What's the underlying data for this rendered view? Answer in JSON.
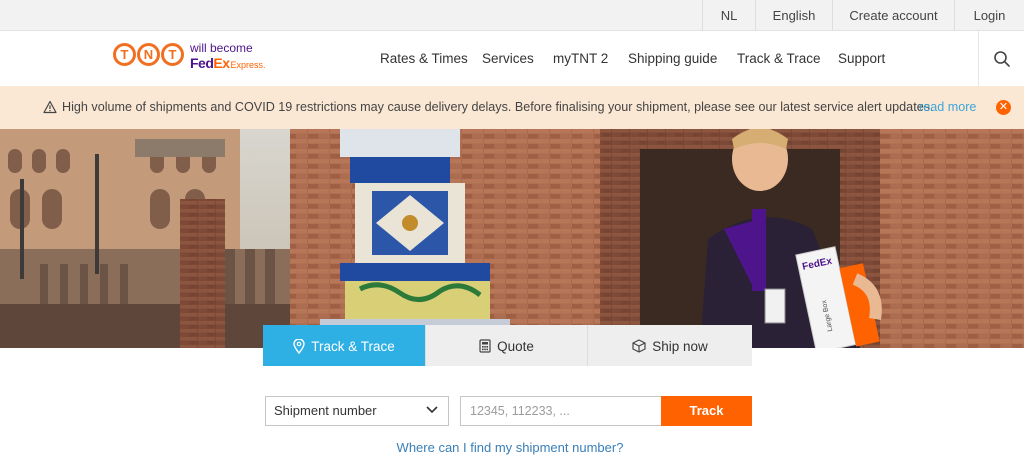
{
  "topbar": {
    "lang_nl": "NL",
    "lang_en": "English",
    "create_account": "Create account",
    "login": "Login"
  },
  "logo": {
    "tnt_letters": [
      "T",
      "N",
      "T"
    ],
    "will_become": "will become",
    "fedex_fed": "Fed",
    "fedex_ex": "Ex",
    "fedex_express": "Express."
  },
  "nav": {
    "items": [
      "Rates & Times",
      "Services",
      "myTNT 2",
      "Shipping guide",
      "Track & Trace",
      "Support"
    ],
    "search_icon": "search-icon"
  },
  "alert": {
    "icon": "warning-icon",
    "text": "High volume of shipments and COVID 19 restrictions may cause delivery delays. Before finalising your shipment, please see our latest service alert updates.",
    "link": "read more",
    "close_icon": "close-icon"
  },
  "hero": {
    "badge_text": "FedEx",
    "box_label": "Large Box"
  },
  "tabs": {
    "track": "Track & Trace",
    "quote": "Quote",
    "ship": "Ship now",
    "active": "track"
  },
  "form": {
    "select_value": "Shipment number",
    "input_placeholder": "12345, 112233, ...",
    "input_value": "",
    "button": "Track",
    "help_link": "Where can I find my shipment number?"
  },
  "colors": {
    "tnt_orange": "#f26f21",
    "fedex_purple": "#4d148c",
    "fedex_orange": "#ff6200",
    "tab_active": "#2eb0e4",
    "alert_bg": "#fbe8d4",
    "link": "#3ca5d9"
  }
}
